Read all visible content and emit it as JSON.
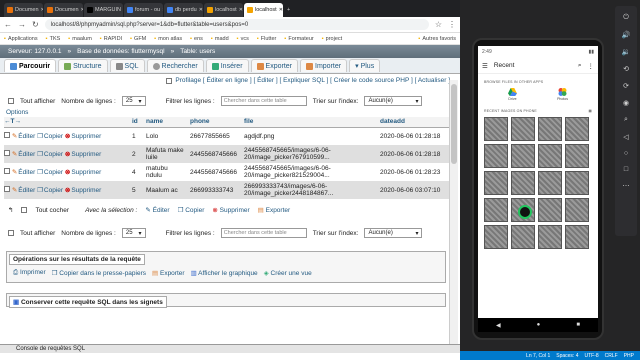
{
  "browser": {
    "tabs": [
      "Documen",
      "Documen",
      "MARGUIN",
      "forum - ou",
      "db perdu",
      "localhost",
      "localhost"
    ],
    "url": "localhost/8/phpmyadmin/sql.php?server=1&db=flutter&table=users&pos=0",
    "bookmarks": [
      "Applications",
      "TKS",
      "maalum",
      "RAPIDI",
      "GFM",
      "mon atlas",
      "ens",
      "madd",
      "vcs",
      "Flutter",
      "Formateur",
      "project",
      "Autres favoris"
    ]
  },
  "pma": {
    "breadcrumb": [
      "Serveur: 127.0.0.1",
      "Base de données: fluttermysql",
      "Table: users"
    ],
    "tabs": [
      "Parcourir",
      "Structure",
      "SQL",
      "Rechercher",
      "Insérer",
      "Exporter",
      "Importer",
      "Plus"
    ],
    "profil": "Profilage [ Éditer en ligne ] [ Éditer ] [ Expliquer SQL ] [ Créer le code source PHP ] [ Actualiser ]",
    "filter": {
      "show_all": "Tout afficher",
      "rows_label": "Nombre de lignes :",
      "rows_value": "25",
      "filter_label": "Filtrer les lignes :",
      "filter_placeholder": "Chercher dans cette table",
      "sort_label": "Trier sur l'index:",
      "sort_value": "Aucun(e)"
    },
    "options": "Options",
    "columns": [
      "id",
      "name",
      "phone",
      "file",
      "dateadd"
    ],
    "actions": {
      "edit": "Éditer",
      "copy": "Copier",
      "delete": "Supprimer"
    },
    "rows": [
      {
        "id": "1",
        "name": "Lolo",
        "phone": "26677855665",
        "file": "agdjdf.png",
        "dateadd": "2020-06-06 01:28:18"
      },
      {
        "id": "2",
        "name": "Mafuta make\nluile",
        "phone": "2445568745666",
        "file": "2445568745665/images/6-06-\n20/image_picker767910599...",
        "dateadd": "2020-06-06 01:28:18"
      },
      {
        "id": "4",
        "name": "matubu\nndulu",
        "phone": "2445568745666",
        "file": "2445568745665/images/6-06-\n20/image_picker821529004...",
        "dateadd": "2020-06-06 01:28:23"
      },
      {
        "id": "5",
        "name": "Maalum ac",
        "phone": "266993333743",
        "file": "266993333743/images/6-06-\n20/image_picker2448184867...",
        "dateadd": "2020-06-06 03:07:10"
      }
    ],
    "bulk": {
      "check_all": "Tout cocher",
      "with_selection": "Avec la sélection :",
      "edit": "Éditer",
      "copy": "Copier",
      "delete": "Supprimer",
      "export": "Exporter"
    },
    "ops_legend": "Opérations sur les résultats de la requête",
    "ops": [
      "Imprimer",
      "Copier dans le presse-papiers",
      "Exporter",
      "Afficher le graphique",
      "Créer une vue"
    ],
    "bookmark_legend": "Conserver cette requête SQL dans les signets",
    "console": "Console de requêtes SQL"
  },
  "phone": {
    "time": "2:49",
    "title": "Recent",
    "section1": "BROWSE FILES IN OTHER APPS",
    "apps": [
      "Drive",
      "Photos"
    ],
    "section2": "RECENT IMAGES ON PHONE"
  },
  "status_bar": [
    "Ln 7, Col 1",
    "Spaces: 4",
    "UTF-8",
    "CRLF",
    "PHP"
  ]
}
